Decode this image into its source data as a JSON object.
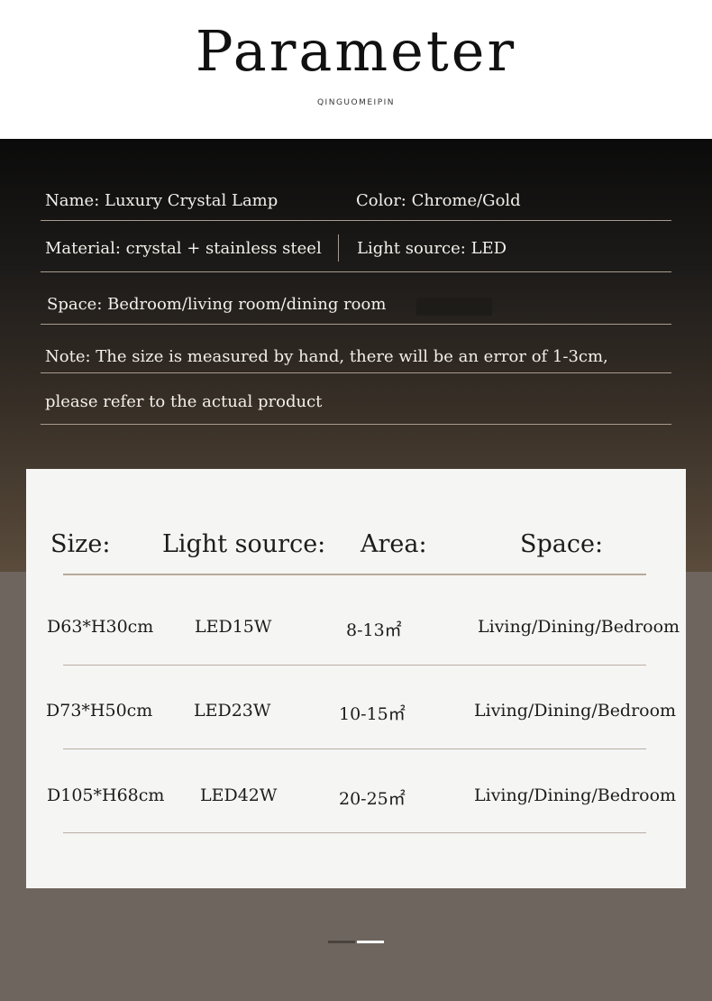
{
  "header": {
    "title": "Parameter",
    "subtitle": "QINGUOMEIPIN"
  },
  "specs": {
    "name": "Name: Luxury Crystal Lamp",
    "color": "Color: Chrome/Gold",
    "material": "Material: crystal + stainless steel",
    "light_source": "Light source: LED",
    "space": "Space: Bedroom/living room/dining room",
    "note_line1": "Note: The size is measured by hand, there will be an error of 1-3cm,",
    "note_line2": "please refer to the actual product"
  },
  "table": {
    "headers": [
      "Size:",
      "Light source:",
      "Area:",
      "Space:"
    ],
    "rows": [
      [
        "D63*H30cm",
        "LED15W",
        "8-13㎡",
        "Living/Dining/Bedroom"
      ],
      [
        "D73*H50cm",
        "LED23W",
        "10-15㎡",
        "Living/Dining/Bedroom"
      ],
      [
        "D105*H68cm",
        "LED42W",
        "20-25㎡",
        "Living/Dining/Bedroom"
      ]
    ]
  },
  "pager": {
    "active_index": 1,
    "count": 2
  },
  "colors": {
    "accent_line": "#a89b8d",
    "card_bg": "#f5f5f4",
    "lower_bg": "#6e655f"
  }
}
